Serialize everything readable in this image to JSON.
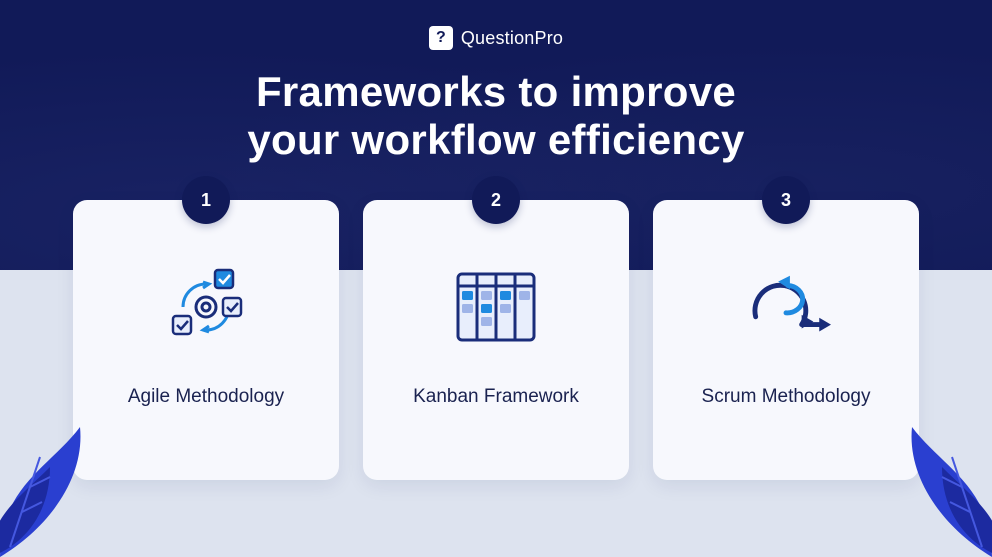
{
  "brand": {
    "mark": "?",
    "name": "QuestionPro"
  },
  "headline_line1": "Frameworks to improve",
  "headline_line2": "your workflow efficiency",
  "cards": [
    {
      "num": "1",
      "label": "Agile Methodology"
    },
    {
      "num": "2",
      "label": "Kanban Framework"
    },
    {
      "num": "3",
      "label": "Scrum Methodology"
    }
  ],
  "colors": {
    "navy": "#111a58",
    "accent": "#1f8ae0",
    "card_bg": "#f7f8fd",
    "page_bg": "#dde3ef"
  }
}
